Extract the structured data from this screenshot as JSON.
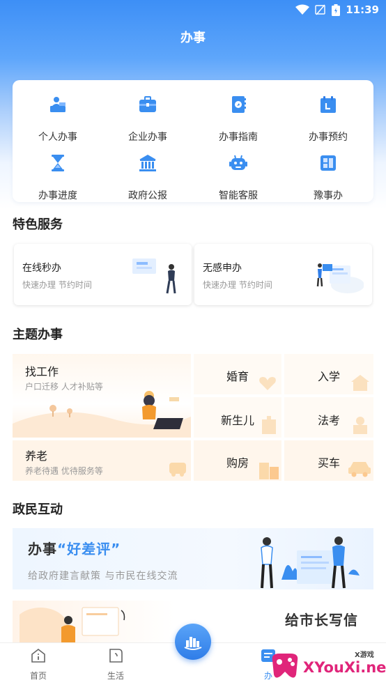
{
  "status_bar": {
    "time": "11:39"
  },
  "header": {
    "title": "办事"
  },
  "quick_grid": [
    {
      "label": "个人办事",
      "icon": "person-desk-icon"
    },
    {
      "label": "企业办事",
      "icon": "briefcase-icon"
    },
    {
      "label": "办事指南",
      "icon": "guide-book-icon"
    },
    {
      "label": "办事预约",
      "icon": "calendar-icon"
    },
    {
      "label": "办事进度",
      "icon": "hourglass-icon"
    },
    {
      "label": "政府公报",
      "icon": "government-building-icon"
    },
    {
      "label": "智能客服",
      "icon": "robot-icon"
    },
    {
      "label": "豫事办",
      "icon": "yu-app-icon"
    }
  ],
  "featured": {
    "title": "特色服务",
    "cards": [
      {
        "title": "在线秒办",
        "subtitle": "快速办理 节约时间"
      },
      {
        "title": "无感申办",
        "subtitle": "快速办理 节约时间"
      }
    ]
  },
  "topics": {
    "title": "主题办事",
    "job": {
      "title": "找工作",
      "subtitle": "户口迁移 人才补贴等"
    },
    "elderly": {
      "title": "养老",
      "subtitle": "养老待遇 优待服务等"
    },
    "marriage": "婚育",
    "school": "入学",
    "newborn": "新生儿",
    "law_exam": "法考",
    "house": "购房",
    "car": "买车"
  },
  "interaction": {
    "title": "政民互动",
    "review": {
      "prefix": "办事",
      "highlight": "“好差评”",
      "subtitle": "给政府建言献策 与市民在线交流"
    },
    "mayor_letter": "给市长写信"
  },
  "tabbar": [
    {
      "label": "首页",
      "icon": "home-icon"
    },
    {
      "label": "生活",
      "icon": "life-icon"
    },
    {
      "label": "办",
      "icon": "affairs-icon"
    }
  ],
  "watermark": {
    "text": "XYouXi.net",
    "cn": "X游戏"
  },
  "colors": {
    "brand": "#3a8ef0",
    "watermark": "#e0257a"
  }
}
